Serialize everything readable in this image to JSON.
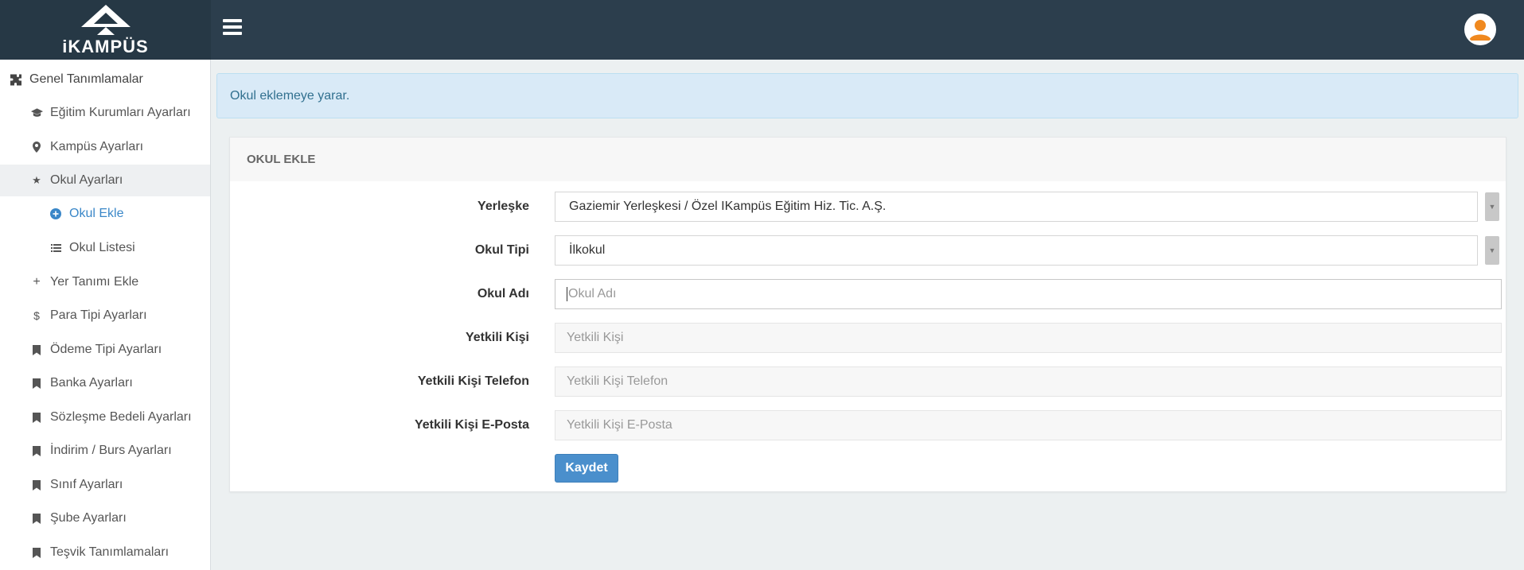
{
  "header": {
    "logo_text": "iKAMPÜS",
    "menu_toggle_icon": "hamburger-icon",
    "avatar_icon": "user-avatar-icon"
  },
  "sidebar": {
    "items": [
      {
        "label": "Genel Tanımlamalar",
        "icon": "puzzle-icon"
      },
      {
        "label": "Eğitim Kurumları Ayarları",
        "icon": "graduation-cap-icon"
      },
      {
        "label": "Kampüs Ayarları",
        "icon": "map-marker-icon"
      },
      {
        "label": "Okul Ayarları",
        "icon": "star-icon"
      },
      {
        "label": "Okul Ekle",
        "icon": "plus-circle-icon"
      },
      {
        "label": "Okul Listesi",
        "icon": "list-icon"
      },
      {
        "label": "Yer Tanımı Ekle",
        "icon": "plus-icon"
      },
      {
        "label": "Para Tipi Ayarları",
        "icon": "dollar-icon"
      },
      {
        "label": "Ödeme Tipi Ayarları",
        "icon": "bookmark-icon"
      },
      {
        "label": "Banka Ayarları",
        "icon": "bookmark-icon"
      },
      {
        "label": "Sözleşme Bedeli Ayarları",
        "icon": "bookmark-icon"
      },
      {
        "label": "İndirim / Burs Ayarları",
        "icon": "bookmark-icon"
      },
      {
        "label": "Sınıf Ayarları",
        "icon": "bookmark-icon"
      },
      {
        "label": "Şube Ayarları",
        "icon": "bookmark-icon"
      },
      {
        "label": "Teşvik Tanımlamaları",
        "icon": "bookmark-icon"
      }
    ]
  },
  "alert": {
    "text": "Okul eklemeye yarar."
  },
  "panel": {
    "title": "OKUL EKLE"
  },
  "form": {
    "campus": {
      "label": "Yerleşke",
      "value": "Gaziemir Yerleşkesi / Özel IKampüs Eğitim Hiz. Tic. A.Ş."
    },
    "school_type": {
      "label": "Okul Tipi",
      "value": "İlkokul"
    },
    "school_name": {
      "label": "Okul Adı",
      "placeholder": "Okul Adı"
    },
    "contact": {
      "label": "Yetkili Kişi",
      "placeholder": "Yetkili Kişi"
    },
    "contact_phone": {
      "label": "Yetkili Kişi Telefon",
      "placeholder": "Yetkili Kişi Telefon"
    },
    "contact_email": {
      "label": "Yetkili Kişi E-Posta",
      "placeholder": "Yetkili Kişi E-Posta"
    },
    "save_label": "Kaydet"
  },
  "colors": {
    "topbar": "#2c3e4d",
    "accent": "#3a87c8",
    "alert_bg": "#d9eaf7",
    "button": "#4a8fcc",
    "avatar": "#f0891f"
  }
}
